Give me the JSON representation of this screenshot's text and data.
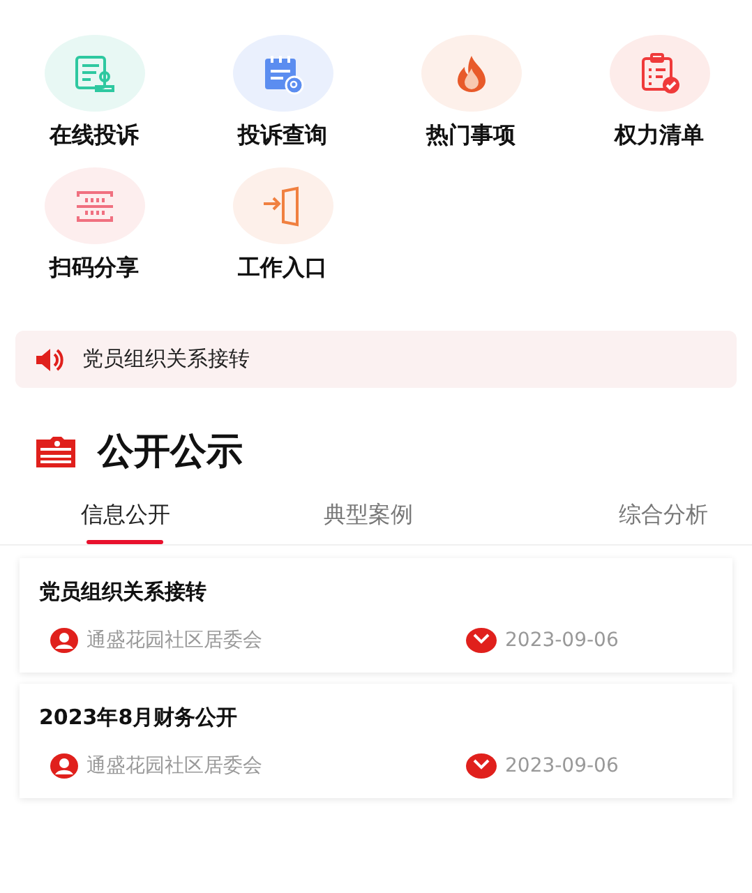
{
  "shortcuts": [
    {
      "label": "在线投诉",
      "kind": "form"
    },
    {
      "label": "投诉查询",
      "kind": "calendar-search"
    },
    {
      "label": "热门事项",
      "kind": "flame"
    },
    {
      "label": "权力清单",
      "kind": "checklist"
    },
    {
      "label": "扫码分享",
      "kind": "scan"
    },
    {
      "label": "工作入口",
      "kind": "enter"
    }
  ],
  "notice": {
    "text": "党员组织关系接转"
  },
  "section": {
    "title": "公开公示"
  },
  "tabs": [
    {
      "label": "信息公开",
      "selected": true
    },
    {
      "label": "典型案例",
      "selected": false
    },
    {
      "label": "综合分析",
      "selected": false
    }
  ],
  "articles": [
    {
      "title": "党员组织关系接转",
      "publisher": "通盛花园社区居委会",
      "date": "2023-09-06"
    },
    {
      "title": "2023年8月财务公开",
      "publisher": "通盛花园社区居委会",
      "date": "2023-09-06"
    }
  ]
}
